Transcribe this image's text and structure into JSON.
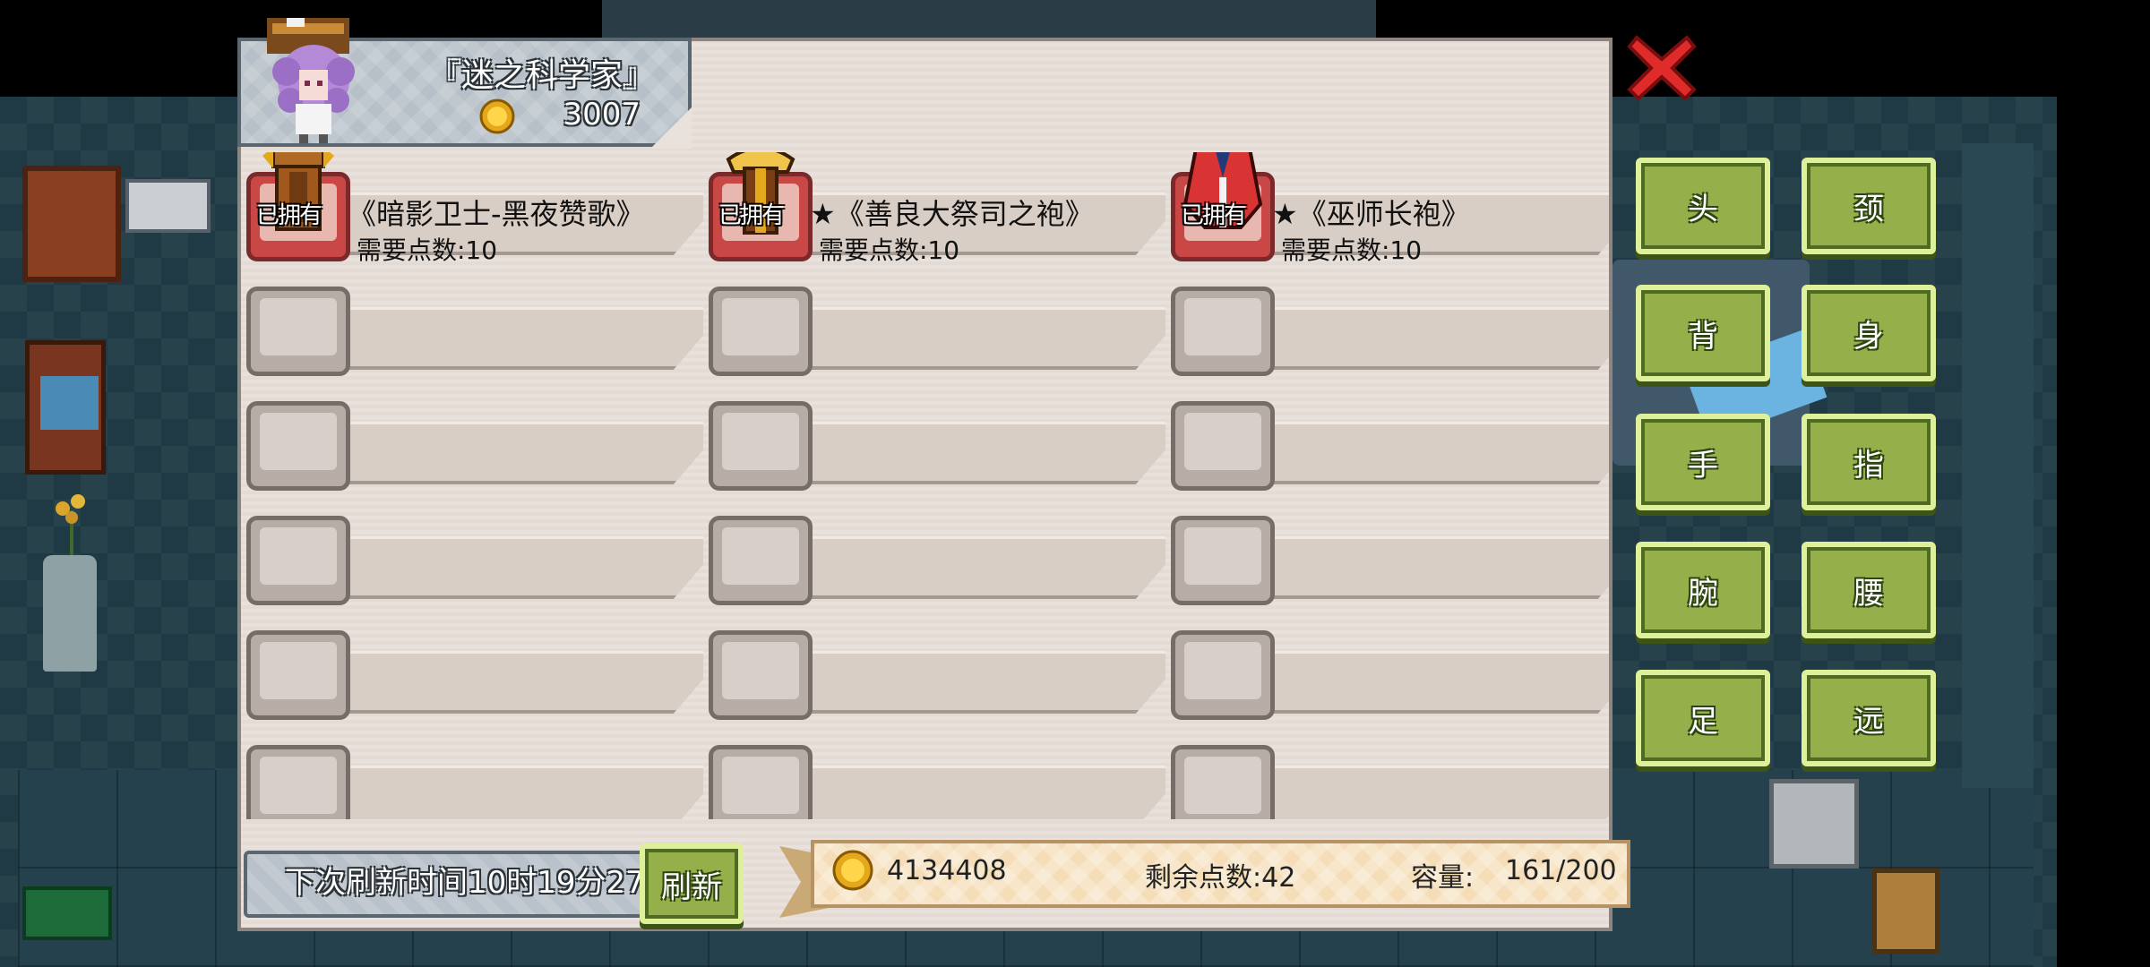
{
  "character": {
    "name": "『迷之科学家』",
    "coins": "3007",
    "avatar_icon": "purple-haired-scientist-avatar",
    "coin_icon": "gold-coin-icon"
  },
  "close_icon": "red-x-close-icon",
  "owned_label": "已拥有",
  "items": [
    {
      "name": "《暗影卫士-黑夜赞歌》",
      "cost": "需要点数:10",
      "icon": "brown-armor-icon",
      "owned": true
    },
    {
      "name": "★《善良大祭司之袍》",
      "cost": "需要点数:10",
      "icon": "gold-priest-robe-icon",
      "owned": true
    },
    {
      "name": "★《巫师长袍》",
      "cost": "需要点数:10",
      "icon": "red-wizard-robe-icon",
      "owned": true
    }
  ],
  "empty_rows": 5,
  "categories": [
    {
      "label": "头"
    },
    {
      "label": "颈"
    },
    {
      "label": "背"
    },
    {
      "label": "身"
    },
    {
      "label": "手"
    },
    {
      "label": "指"
    },
    {
      "label": "腕"
    },
    {
      "label": "腰"
    },
    {
      "label": "足"
    },
    {
      "label": "远"
    }
  ],
  "footer": {
    "refresh_time": "下次刷新时间10时19分27",
    "refresh_button": "刷新",
    "gold": "4134408",
    "points": "剩余点数:42",
    "capacity_label": "容量:",
    "capacity": "161/200"
  },
  "colors": {
    "button_green": "#95b04a",
    "close_red": "#e02b2b",
    "panel_bg": "#e9e1db",
    "ribbon": "#f4ddb7"
  }
}
